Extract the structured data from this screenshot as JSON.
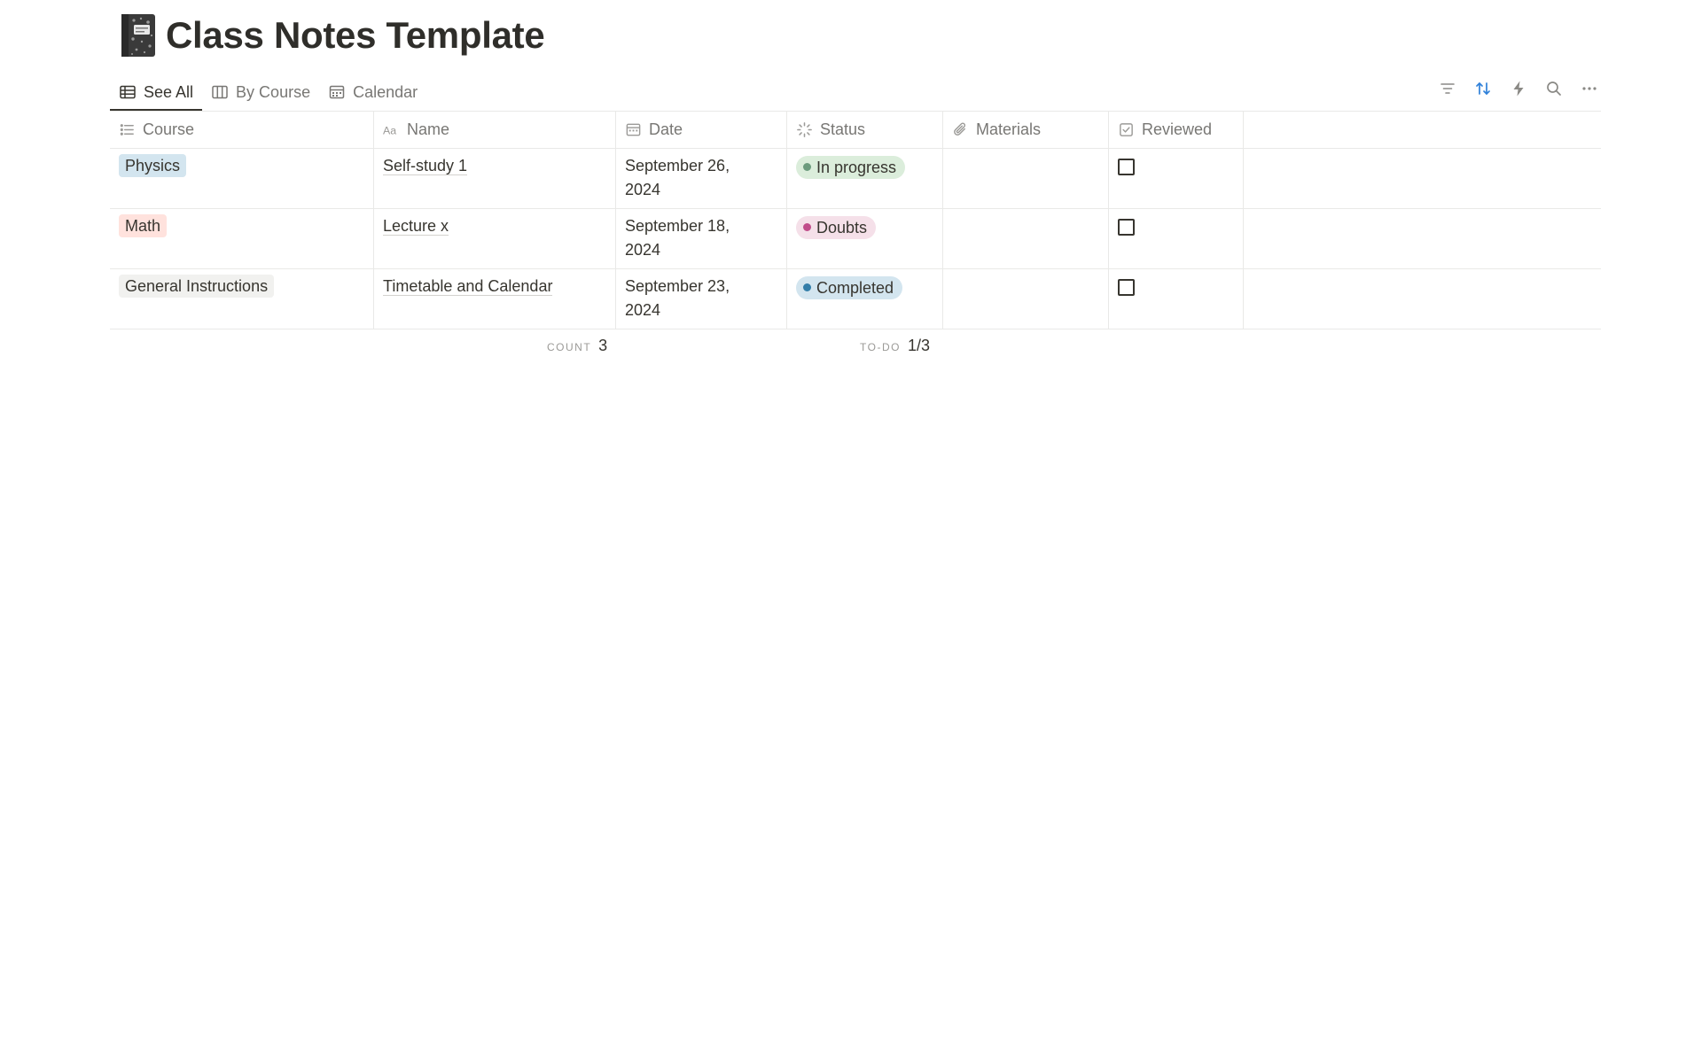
{
  "page": {
    "title": "Class Notes Template",
    "icon": "composition-notebook-icon"
  },
  "tabs": [
    {
      "label": "See All",
      "icon": "table-icon",
      "active": true
    },
    {
      "label": "By Course",
      "icon": "board-columns-icon",
      "active": false
    },
    {
      "label": "Calendar",
      "icon": "calendar-icon",
      "active": false
    }
  ],
  "toolbar": {
    "icons": [
      "filter-icon",
      "sort-icon",
      "lightning-icon",
      "search-icon",
      "more-icon"
    ],
    "sort_active_color": "#2f80d9"
  },
  "columns": [
    {
      "label": "Course",
      "icon": "list-icon"
    },
    {
      "label": "Name",
      "icon": "text-aa-icon"
    },
    {
      "label": "Date",
      "icon": "calendar-icon"
    },
    {
      "label": "Status",
      "icon": "status-spinner-icon"
    },
    {
      "label": "Materials",
      "icon": "paperclip-icon"
    },
    {
      "label": "Reviewed",
      "icon": "checkbox-icon"
    }
  ],
  "rows": [
    {
      "course": "Physics",
      "course_color": "#d3e5ef",
      "name": "Self-study 1",
      "date_line1": "September 26,",
      "date_line2": "2024",
      "status": "In progress",
      "status_bg": "#dbeddb",
      "status_dot": "#6c9b7d",
      "materials": "",
      "reviewed": false
    },
    {
      "course": "Math",
      "course_color": "#ffe2dd",
      "name": "Lecture x",
      "date_line1": "September 18,",
      "date_line2": "2024",
      "status": "Doubts",
      "status_bg": "#f5e0e9",
      "status_dot": "#c14c8a",
      "materials": "",
      "reviewed": false
    },
    {
      "course": "General Instructions",
      "course_color": "#f1f1ef",
      "name": "Timetable and Calendar",
      "date_line1": "September 23,",
      "date_line2": "2024",
      "status": "Completed",
      "status_bg": "#d3e5ef",
      "status_dot": "#337ea9",
      "materials": "",
      "reviewed": false
    }
  ],
  "summary": {
    "count_label": "COUNT",
    "count_value": "3",
    "todo_label": "TO-DO",
    "todo_value": "1/3"
  }
}
